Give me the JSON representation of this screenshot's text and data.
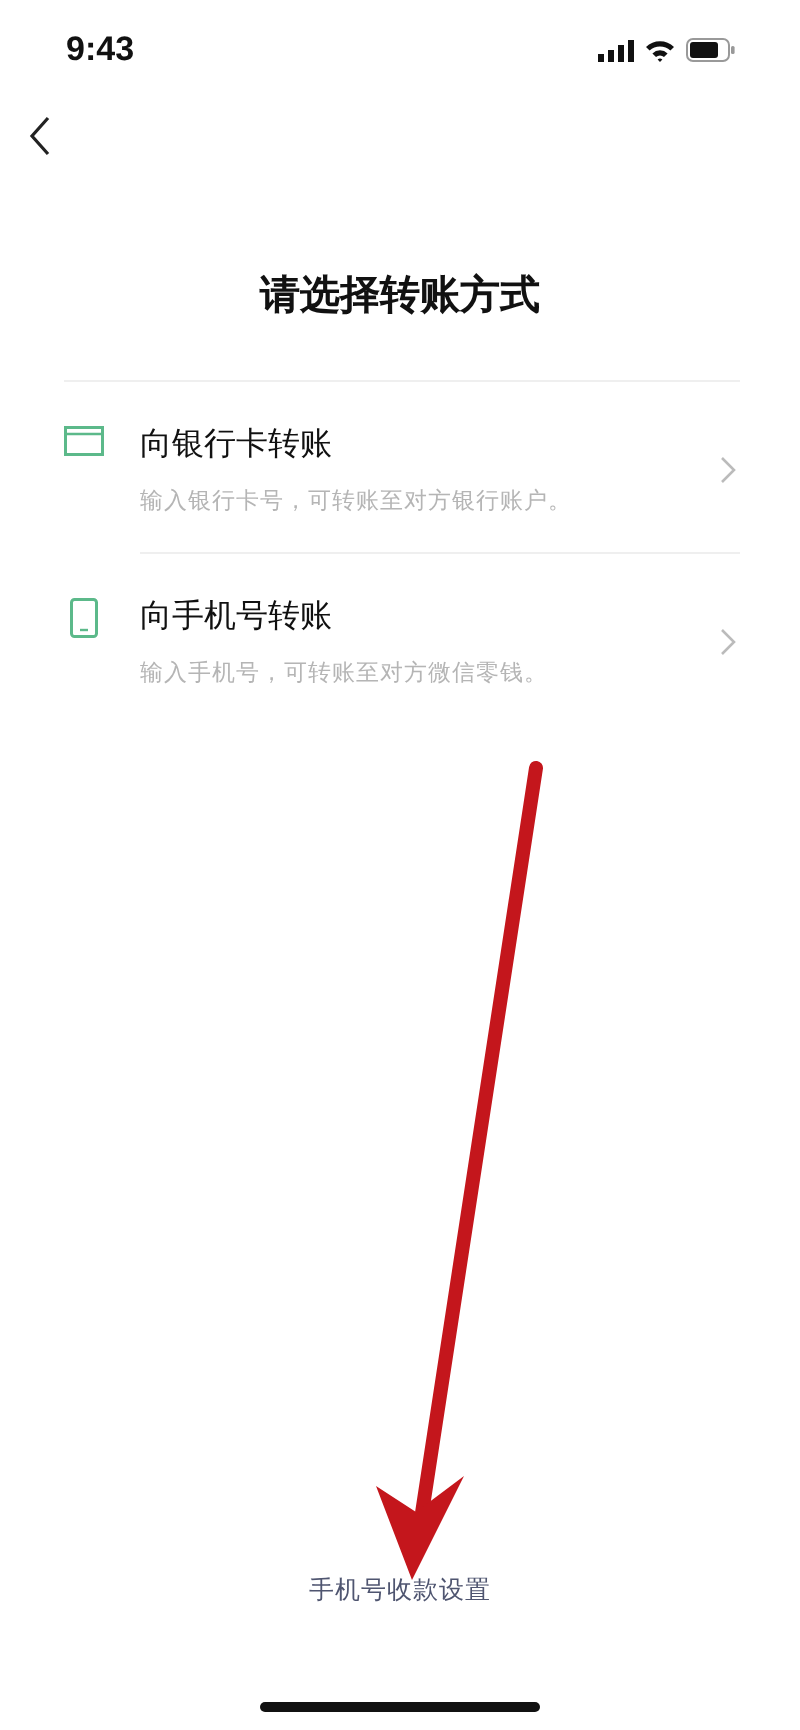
{
  "status_bar": {
    "time": "9:43"
  },
  "title": "请选择转账方式",
  "options": [
    {
      "kind": "card",
      "title": "向银行卡转账",
      "subtitle": "输入银行卡号，可转账至对方银行账户。"
    },
    {
      "kind": "phone",
      "title": "向手机号转账",
      "subtitle": "输入手机号，可转账至对方微信零钱。"
    }
  ],
  "footer_link": "手机号收款设置"
}
